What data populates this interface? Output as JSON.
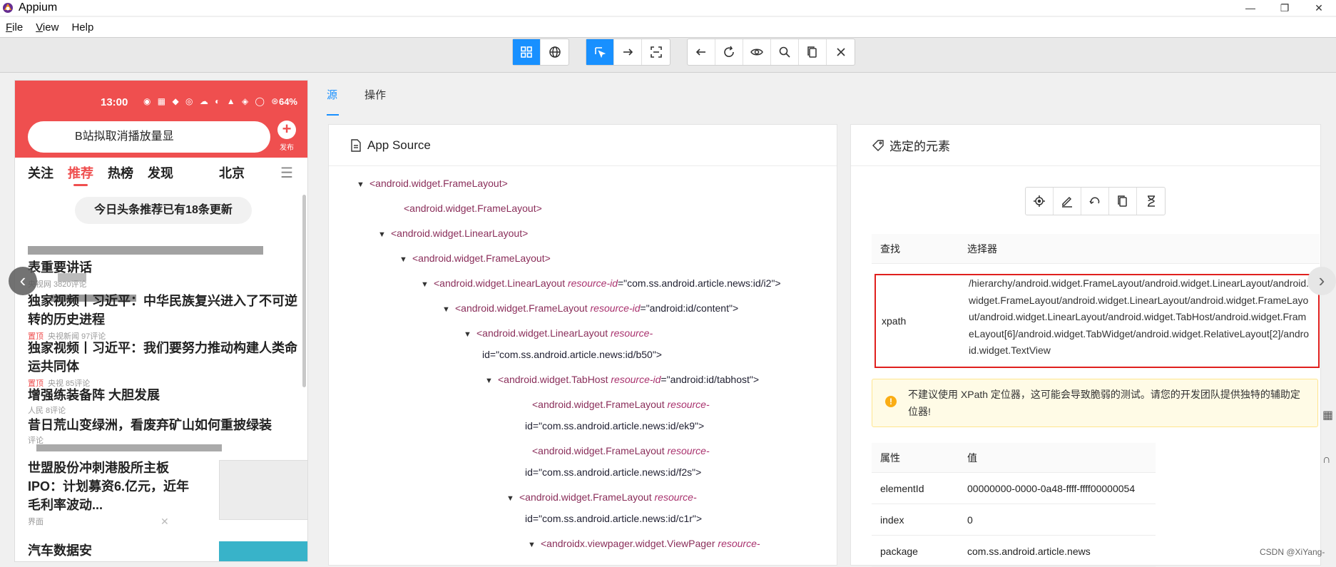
{
  "window": {
    "title": "Appium"
  },
  "menu": [
    {
      "key": "F",
      "rest": "ile"
    },
    {
      "key": "V",
      "rest": "iew"
    },
    {
      "key": "",
      "rest": "Help"
    }
  ],
  "phone": {
    "time": "13:00",
    "battery": "64%",
    "search_text": "B站拟取消播放量显",
    "publish_label": "发布",
    "tabs": [
      "关注",
      "推荐",
      "热榜",
      "发现",
      "北京"
    ],
    "update_pill": "今日头条推荐已有18条更新",
    "news": [
      {
        "title": "表重要讲话",
        "meta_tag": "",
        "meta": "央视网 3820评论"
      },
      {
        "title": "独家视频丨习近平：中华民族复兴进入了不可逆转的历史进程",
        "meta_tag": "置顶",
        "meta": "央视新闻 97评论"
      },
      {
        "title": "独家视频丨习近平：我们要努力推动构建人类命运共同体",
        "meta_tag": "置顶",
        "meta": "央视 85评论"
      },
      {
        "title": "增强练装备阵 大胆发展",
        "meta_tag": "",
        "meta": "人民 8评论"
      },
      {
        "title": "昔日荒山变绿洲，看废弃矿山如何重披绿装",
        "meta_tag": "",
        "meta": "评论"
      },
      {
        "title": "世盟股份冲刺港股所主板IPO：计划募资6.亿元，近年毛利率波动...",
        "meta_tag": "",
        "meta": "界面"
      },
      {
        "title": "汽车数据安",
        "meta_tag": "",
        "meta": ""
      }
    ]
  },
  "tabs": {
    "source": "源",
    "actions": "操作"
  },
  "source_panel": {
    "title": "App Source",
    "nodes": [
      {
        "caret": "▼",
        "tag": "<android.widget.FrameLayout>",
        "attr": "",
        "value": "",
        "cont": ""
      },
      {
        "caret": "",
        "tag": "<android.widget.FrameLayout>",
        "attr": "",
        "value": "",
        "cont": ""
      },
      {
        "caret": "▼",
        "tag": "<android.widget.LinearLayout>",
        "attr": "",
        "value": "",
        "cont": ""
      },
      {
        "caret": "▼",
        "tag": "<android.widget.FrameLayout>",
        "attr": "",
        "value": "",
        "cont": ""
      },
      {
        "caret": "▼",
        "tag": "<android.widget.LinearLayout",
        "attr": "resource-id",
        "value": "=\"com.ss.android.article.news:id/i2\">",
        "cont": ""
      },
      {
        "caret": "▼",
        "tag": "<android.widget.FrameLayout",
        "attr": "resource-id",
        "value": "=\"android:id/content\">",
        "cont": ""
      },
      {
        "caret": "▼",
        "tag": "<android.widget.LinearLayout",
        "attr": "resource-",
        "value": "",
        "cont": "id=\"com.ss.android.article.news:id/b50\">"
      },
      {
        "caret": "▼",
        "tag": "<android.widget.TabHost",
        "attr": "resource-id",
        "value": "=\"android:id/tabhost\">",
        "cont": ""
      },
      {
        "caret": "",
        "tag": "<android.widget.FrameLayout",
        "attr": "resource-",
        "value": "",
        "cont": "id=\"com.ss.android.article.news:id/ek9\">"
      },
      {
        "caret": "",
        "tag": "<android.widget.FrameLayout",
        "attr": "resource-",
        "value": "",
        "cont": "id=\"com.ss.android.article.news:id/f2s\">"
      },
      {
        "caret": "▼",
        "tag": "<android.widget.FrameLayout",
        "attr": "resource-",
        "value": "",
        "cont": "id=\"com.ss.android.article.news:id/c1r\">"
      },
      {
        "caret": "▼",
        "tag": "<androidx.viewpager.widget.ViewPager",
        "attr": "resource-",
        "value": "",
        "cont": ""
      }
    ]
  },
  "selected_panel": {
    "title": "选定的元素",
    "find_header": "查找",
    "selector_header": "选择器",
    "xpath_label": "xpath",
    "xpath_value": "/hierarchy/android.widget.FrameLayout/android.widget.LinearLayout/android.widget.FrameLayout/android.widget.LinearLayout/android.widget.FrameLayout/android.widget.LinearLayout/android.widget.TabHost/android.widget.FrameLayout[6]/android.widget.TabWidget/android.widget.RelativeLayout[2]/android.widget.TextView",
    "warning": "不建议使用 XPath 定位器，这可能会导致脆弱的测试。请您的开发团队提供独特的辅助定位器!",
    "attr_header": "属性",
    "value_header": "值",
    "attributes": [
      {
        "name": "elementId",
        "value": "00000000-0000-0a48-ffff-ffff00000054"
      },
      {
        "name": "index",
        "value": "0"
      },
      {
        "name": "package",
        "value": "com.ss.android.article.news"
      }
    ]
  },
  "watermark": "CSDN @XiYang-",
  "colors": {
    "accent": "#1890ff",
    "phone_red": "#ef4f4f",
    "highlight_border": "#e0201e",
    "warn_bg": "#fffbe6"
  }
}
